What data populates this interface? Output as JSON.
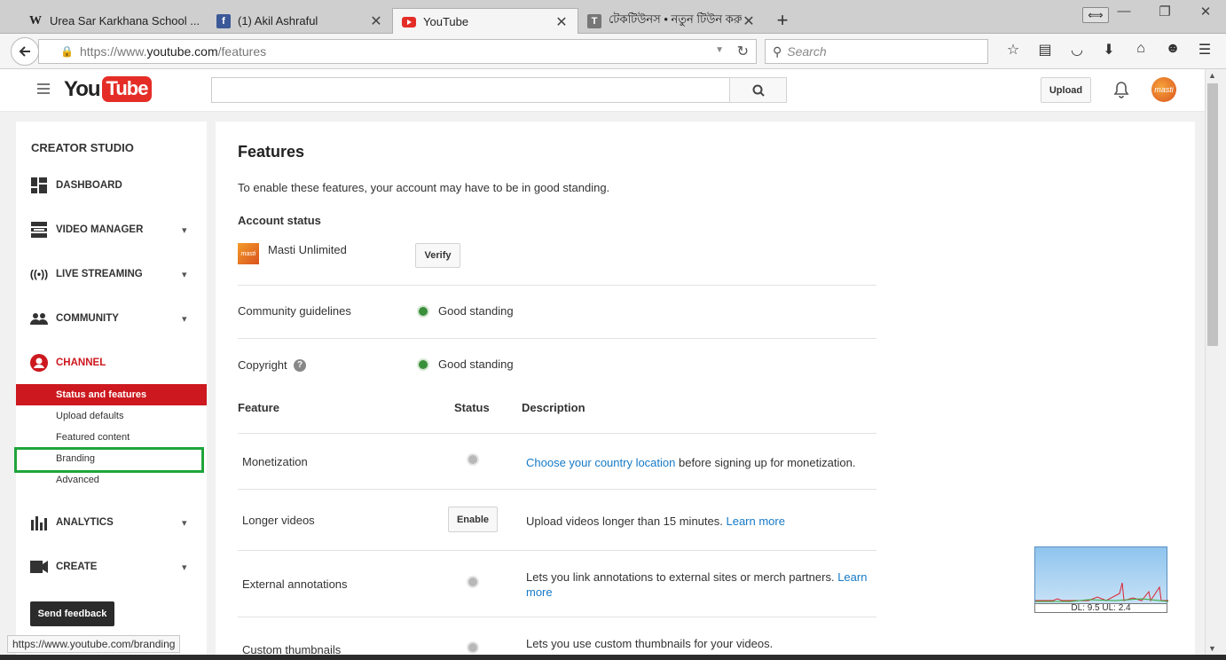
{
  "browser": {
    "tabs": [
      {
        "favicon": "W",
        "title": "Urea Sar Karkhana School ...",
        "active": false
      },
      {
        "favicon": "f",
        "title": "(1) Akil Ashraful",
        "active": false
      },
      {
        "favicon": "yt",
        "title": "YouTube",
        "active": true
      },
      {
        "favicon": "T",
        "title": "টেকটিউনস • নতুন টিউন করুন",
        "active": false
      }
    ],
    "url_prefix": "https://www.",
    "url_domain": "youtube.com",
    "url_path": "/features",
    "search_placeholder": "Search",
    "status_url": "https://www.youtube.com/branding",
    "net_graph_label": "DL: 9.5 UL: 2.4"
  },
  "yt_header": {
    "logo_you": "You",
    "logo_tube": "Tube",
    "upload_label": "Upload",
    "avatar_text": "masti"
  },
  "sidebar": {
    "title": "CREATOR STUDIO",
    "items": [
      {
        "label": "DASHBOARD",
        "icon": "dashboard-icon",
        "chevron": false
      },
      {
        "label": "VIDEO MANAGER",
        "icon": "video-manager-icon",
        "chevron": true
      },
      {
        "label": "LIVE STREAMING",
        "icon": "live-streaming-icon",
        "chevron": true
      },
      {
        "label": "COMMUNITY",
        "icon": "community-icon",
        "chevron": true
      },
      {
        "label": "CHANNEL",
        "icon": "channel-icon",
        "chevron": false
      },
      {
        "label": "ANALYTICS",
        "icon": "analytics-icon",
        "chevron": true
      },
      {
        "label": "CREATE",
        "icon": "create-icon",
        "chevron": true
      }
    ],
    "channel_sub": [
      {
        "label": "Status and features",
        "active": true
      },
      {
        "label": "Upload defaults",
        "active": false
      },
      {
        "label": "Featured content",
        "active": false
      },
      {
        "label": "Branding",
        "active": false
      },
      {
        "label": "Advanced",
        "active": false
      }
    ],
    "feedback_label": "Send feedback"
  },
  "main": {
    "title": "Features",
    "intro": "To enable these features, your account may have to be in good standing.",
    "account_status_heading": "Account status",
    "account_name": "Masti Unlimited",
    "account_thumb_text": "masti",
    "verify_label": "Verify",
    "community_label": "Community guidelines",
    "community_status": "Good standing",
    "copyright_label": "Copyright",
    "copyright_status": "Good standing",
    "col_feature": "Feature",
    "col_status": "Status",
    "col_description": "Description",
    "features": {
      "monetization": {
        "name": "Monetization",
        "desc_link": "Choose your country location",
        "desc_text": " before signing up for monetization."
      },
      "longer": {
        "name": "Longer videos",
        "button": "Enable",
        "desc_text": "Upload videos longer than 15 minutes. ",
        "desc_link": "Learn more"
      },
      "annotations": {
        "name": "External annotations",
        "desc_text": "Lets you link annotations to external sites or merch partners. ",
        "desc_link": "Learn more"
      },
      "thumbnails": {
        "name": "Custom thumbnails",
        "desc_text": "Lets you use custom thumbnails for your videos."
      }
    }
  }
}
